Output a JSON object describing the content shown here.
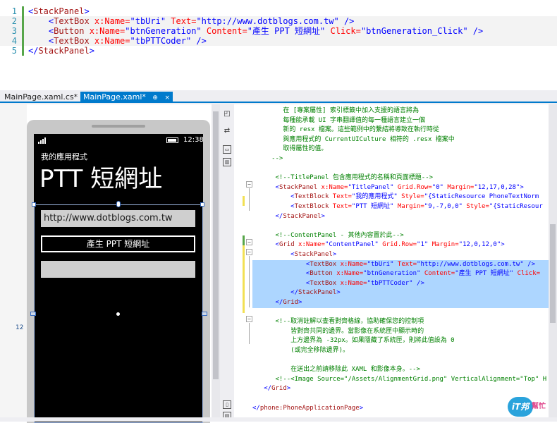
{
  "snippet": {
    "lines": [
      {
        "num": "1",
        "parts": [
          {
            "t": "<",
            "c": "c-b"
          },
          {
            "t": "StackPanel",
            "c": "c-m"
          },
          {
            "t": ">",
            "c": "c-b"
          }
        ]
      },
      {
        "num": "2",
        "parts": [
          {
            "t": "    <",
            "c": "c-b"
          },
          {
            "t": "TextBox",
            "c": "c-m"
          },
          {
            "t": " x:Name=",
            "c": "c-r"
          },
          {
            "t": "\"tbUri\"",
            "c": "c-b"
          },
          {
            "t": " Text=",
            "c": "c-r"
          },
          {
            "t": "\"http://www.dotblogs.com.tw\"",
            "c": "c-b"
          },
          {
            "t": " />",
            "c": "c-b"
          }
        ]
      },
      {
        "num": "3",
        "parts": [
          {
            "t": "    <",
            "c": "c-b"
          },
          {
            "t": "Button",
            "c": "c-m"
          },
          {
            "t": " x:Name=",
            "c": "c-r"
          },
          {
            "t": "\"btnGeneration\"",
            "c": "c-b"
          },
          {
            "t": " Content=",
            "c": "c-r"
          },
          {
            "t": "\"產生 PPT 短網址\"",
            "c": "c-b"
          },
          {
            "t": " Click=",
            "c": "c-r"
          },
          {
            "t": "\"btnGeneration_Click\"",
            "c": "c-b"
          },
          {
            "t": " />",
            "c": "c-b"
          }
        ]
      },
      {
        "num": "4",
        "parts": [
          {
            "t": "    <",
            "c": "c-b"
          },
          {
            "t": "TextBox",
            "c": "c-m"
          },
          {
            "t": " x:Name=",
            "c": "c-r"
          },
          {
            "t": "\"tbPTTCoder\"",
            "c": "c-b"
          },
          {
            "t": " />",
            "c": "c-b"
          }
        ]
      },
      {
        "num": "5",
        "parts": [
          {
            "t": "</",
            "c": "c-b"
          },
          {
            "t": "StackPanel",
            "c": "c-m"
          },
          {
            "t": ">",
            "c": "c-b"
          }
        ]
      }
    ]
  },
  "tabs": {
    "cs": "MainPage.xaml.cs*",
    "xaml": "MainPage.xaml*",
    "pin": "⊕",
    "close": "×"
  },
  "phone": {
    "time": "12:38",
    "app_title": "我的應用程式",
    "page_title": "PTT 短網址",
    "uri_text": "http://www.dotblogs.com.tw",
    "button_label": "產生 PPT 短網址",
    "margin_value": "12"
  },
  "xaml": {
    "lines": [
      [
        {
          "t": "        在 [專案屬性] 索引標籤中加入支援的語言將為",
          "c": "c-g"
        }
      ],
      [
        {
          "t": "        每種能承載 UI 字串翻譯值的每一種語言建立一個",
          "c": "c-g"
        }
      ],
      [
        {
          "t": "        新的 resx 檔案。這些範例中的繫結將導致在執行時從",
          "c": "c-g"
        }
      ],
      [
        {
          "t": "        與應用程式的 CurrentUICulture 相符的 .resx 檔案中",
          "c": "c-g"
        }
      ],
      [
        {
          "t": "        取得屬性的值。",
          "c": "c-g"
        }
      ],
      [
        {
          "t": "     -->",
          "c": "c-g"
        }
      ],
      [
        {
          "t": "",
          "c": "c-g"
        }
      ],
      [
        {
          "t": "      <!--TitlePanel 包含應用程式的名稱和頁面標題-->",
          "c": "c-g"
        }
      ],
      [
        {
          "t": "      <",
          "c": "c-b"
        },
        {
          "t": "StackPanel",
          "c": "c-m"
        },
        {
          "t": " x:Name=",
          "c": "c-r"
        },
        {
          "t": "\"TitlePanel\"",
          "c": "c-b"
        },
        {
          "t": " Grid.Row=",
          "c": "c-r"
        },
        {
          "t": "\"0\"",
          "c": "c-b"
        },
        {
          "t": " Margin=",
          "c": "c-r"
        },
        {
          "t": "\"12,17,0,28\"",
          "c": "c-b"
        },
        {
          "t": ">",
          "c": "c-b"
        }
      ],
      [
        {
          "t": "          <",
          "c": "c-b"
        },
        {
          "t": "TextBlock",
          "c": "c-m"
        },
        {
          "t": " Text=",
          "c": "c-r"
        },
        {
          "t": "\"我的應用程式\"",
          "c": "c-b"
        },
        {
          "t": " Style=",
          "c": "c-r"
        },
        {
          "t": "\"{StaticResource PhoneTextNorm",
          "c": "c-b"
        }
      ],
      [
        {
          "t": "          <",
          "c": "c-b"
        },
        {
          "t": "TextBlock",
          "c": "c-m"
        },
        {
          "t": " Text=",
          "c": "c-r"
        },
        {
          "t": "\"PTT 短網址\"",
          "c": "c-b"
        },
        {
          "t": " Margin=",
          "c": "c-r"
        },
        {
          "t": "\"9,-7,0,0\"",
          "c": "c-b"
        },
        {
          "t": " Style=",
          "c": "c-r"
        },
        {
          "t": "\"{StaticResour",
          "c": "c-b"
        }
      ],
      [
        {
          "t": "      </",
          "c": "c-b"
        },
        {
          "t": "StackPanel",
          "c": "c-m"
        },
        {
          "t": ">",
          "c": "c-b"
        }
      ],
      [
        {
          "t": "",
          "c": "c-g"
        }
      ],
      [
        {
          "t": "      <!--ContentPanel - 其他內容置於此-->",
          "c": "c-g"
        }
      ],
      [
        {
          "t": "      <",
          "c": "c-b"
        },
        {
          "t": "Grid",
          "c": "c-m"
        },
        {
          "t": " x:Name=",
          "c": "c-r"
        },
        {
          "t": "\"ContentPanel\"",
          "c": "c-b"
        },
        {
          "t": " Grid.Row=",
          "c": "c-r"
        },
        {
          "t": "\"1\"",
          "c": "c-b"
        },
        {
          "t": " Margin=",
          "c": "c-r"
        },
        {
          "t": "\"12,0,12,0\"",
          "c": "c-b"
        },
        {
          "t": ">",
          "c": "c-b"
        }
      ],
      [
        {
          "t": "          <",
          "c": "c-b"
        },
        {
          "t": "StackPanel",
          "c": "c-m"
        },
        {
          "t": ">",
          "c": "c-b"
        }
      ],
      [
        {
          "t": "              <",
          "c": "c-b"
        },
        {
          "t": "TextBox",
          "c": "c-m"
        },
        {
          "t": " x:Name=",
          "c": "c-r"
        },
        {
          "t": "\"tbUri\"",
          "c": "c-b"
        },
        {
          "t": " Text=",
          "c": "c-r"
        },
        {
          "t": "\"http://www.dotblogs.com.tw\"",
          "c": "c-b"
        },
        {
          "t": " />",
          "c": "c-b"
        }
      ],
      [
        {
          "t": "              <",
          "c": "c-b"
        },
        {
          "t": "Button",
          "c": "c-m"
        },
        {
          "t": " x:Name=",
          "c": "c-r"
        },
        {
          "t": "\"btnGeneration\"",
          "c": "c-b"
        },
        {
          "t": " Content=",
          "c": "c-r"
        },
        {
          "t": "\"產生 PPT 短網址\"",
          "c": "c-b"
        },
        {
          "t": " Click=",
          "c": "c-r"
        }
      ],
      [
        {
          "t": "              <",
          "c": "c-b"
        },
        {
          "t": "TextBox",
          "c": "c-m"
        },
        {
          "t": " x:Name=",
          "c": "c-r"
        },
        {
          "t": "\"tbPTTCoder\"",
          "c": "c-b"
        },
        {
          "t": " />",
          "c": "c-b"
        }
      ],
      [
        {
          "t": "          </",
          "c": "c-b"
        },
        {
          "t": "StackPanel",
          "c": "c-m"
        },
        {
          "t": ">",
          "c": "c-b"
        }
      ],
      [
        {
          "t": "      </",
          "c": "c-b"
        },
        {
          "t": "Grid",
          "c": "c-m"
        },
        {
          "t": ">",
          "c": "c-b"
        }
      ],
      [
        {
          "t": "",
          "c": "c-g"
        }
      ],
      [
        {
          "t": "      <!--取消註解以查看對齊格線，協助確保您的控制項",
          "c": "c-g"
        }
      ],
      [
        {
          "t": "          皆對齊共同的邊界。當影像在系統匣中顯示時的",
          "c": "c-g"
        }
      ],
      [
        {
          "t": "          上方邊界為 -32px。如果隱藏了系統匣，則將此值設為 0",
          "c": "c-g"
        }
      ],
      [
        {
          "t": "          (或完全移除邊界)。",
          "c": "c-g"
        }
      ],
      [
        {
          "t": "",
          "c": "c-g"
        }
      ],
      [
        {
          "t": "          在送出之前請移除此 XAML 和影像本身。-->",
          "c": "c-g"
        }
      ],
      [
        {
          "t": "      <!--<Image Source=\"/Assets/AlignmentGrid.png\" VerticalAlignment=\"Top\" H",
          "c": "c-g"
        }
      ],
      [
        {
          "t": "   </",
          "c": "c-b"
        },
        {
          "t": "Grid",
          "c": "c-m"
        },
        {
          "t": ">",
          "c": "c-b"
        }
      ],
      [
        {
          "t": "",
          "c": "c-g"
        }
      ],
      [
        {
          "t": "</",
          "c": "c-b"
        },
        {
          "t": "phone:PhoneApplicationPage",
          "c": "c-m"
        },
        {
          "t": ">",
          "c": "c-b"
        }
      ]
    ]
  },
  "watermark": {
    "logo": "iT邦",
    "text": "幫忙"
  },
  "colors": {
    "accent": "#007acc",
    "selection": "#add6ff",
    "change_saved": "#57a64a",
    "change_unsaved": "#f2e054"
  }
}
